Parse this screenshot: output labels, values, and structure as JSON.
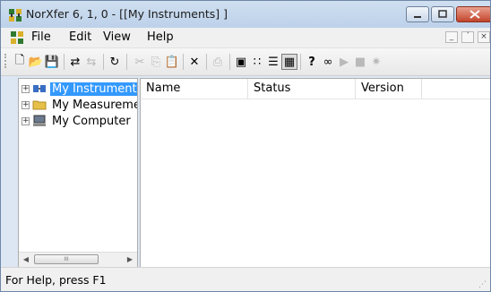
{
  "window": {
    "title": "NorXfer 6, 1, 0 - [[My Instruments] ]",
    "icon": "norxfer-app-icon",
    "controls": [
      "minimize-icon",
      "maximize-icon",
      "close-icon"
    ]
  },
  "menubar": {
    "items": [
      "File",
      "Edit",
      "View",
      "Help"
    ],
    "mdi_controls": [
      "_",
      "´",
      "×"
    ]
  },
  "toolbar": {
    "buttons": [
      {
        "name": "new-icon",
        "glyph": "🗋",
        "enabled": true
      },
      {
        "name": "open-icon",
        "glyph": "📂",
        "enabled": true
      },
      {
        "name": "save-icon",
        "glyph": "💾",
        "enabled": true
      },
      {
        "name": "connect-icon",
        "glyph": "⇄",
        "enabled": true
      },
      {
        "name": "disconnect-icon",
        "glyph": "⇆",
        "enabled": false
      },
      {
        "name": "refresh-icon",
        "glyph": "↻",
        "enabled": true
      },
      {
        "name": "cut-icon",
        "glyph": "✂",
        "enabled": false
      },
      {
        "name": "copy-icon",
        "glyph": "⎘",
        "enabled": false
      },
      {
        "name": "paste-icon",
        "glyph": "📋",
        "enabled": false
      },
      {
        "name": "delete-icon",
        "glyph": "✕",
        "enabled": true
      },
      {
        "name": "print-icon",
        "glyph": "⎙",
        "enabled": false
      },
      {
        "name": "large-icons-icon",
        "glyph": "▣",
        "enabled": true
      },
      {
        "name": "small-icons-icon",
        "glyph": "∷",
        "enabled": true
      },
      {
        "name": "list-view-icon",
        "glyph": "☰",
        "enabled": true
      },
      {
        "name": "details-view-icon",
        "glyph": "▦",
        "enabled": true
      },
      {
        "name": "help-icon",
        "glyph": "?",
        "enabled": true
      },
      {
        "name": "context-help-icon",
        "glyph": "∞",
        "enabled": true
      },
      {
        "name": "play-icon",
        "glyph": "▶",
        "enabled": false
      },
      {
        "name": "stop-icon",
        "glyph": "■",
        "enabled": false
      },
      {
        "name": "record-icon",
        "glyph": "✷",
        "enabled": false
      }
    ]
  },
  "tree": {
    "items": [
      {
        "label": "My Instruments",
        "icon": "instruments-icon",
        "selected": true
      },
      {
        "label": "My Measuremer",
        "icon": "folder-icon",
        "selected": false
      },
      {
        "label": "My Computer",
        "icon": "computer-icon",
        "selected": false
      }
    ],
    "scroll_thumb_glyph": "III"
  },
  "list": {
    "columns": [
      "Name",
      "Status",
      "Version"
    ]
  },
  "statusbar": {
    "text": "For Help, press F1"
  },
  "colors": {
    "selection": "#3399ff",
    "close_button": "#c2442b",
    "titlebar": "#bcd1ea"
  }
}
